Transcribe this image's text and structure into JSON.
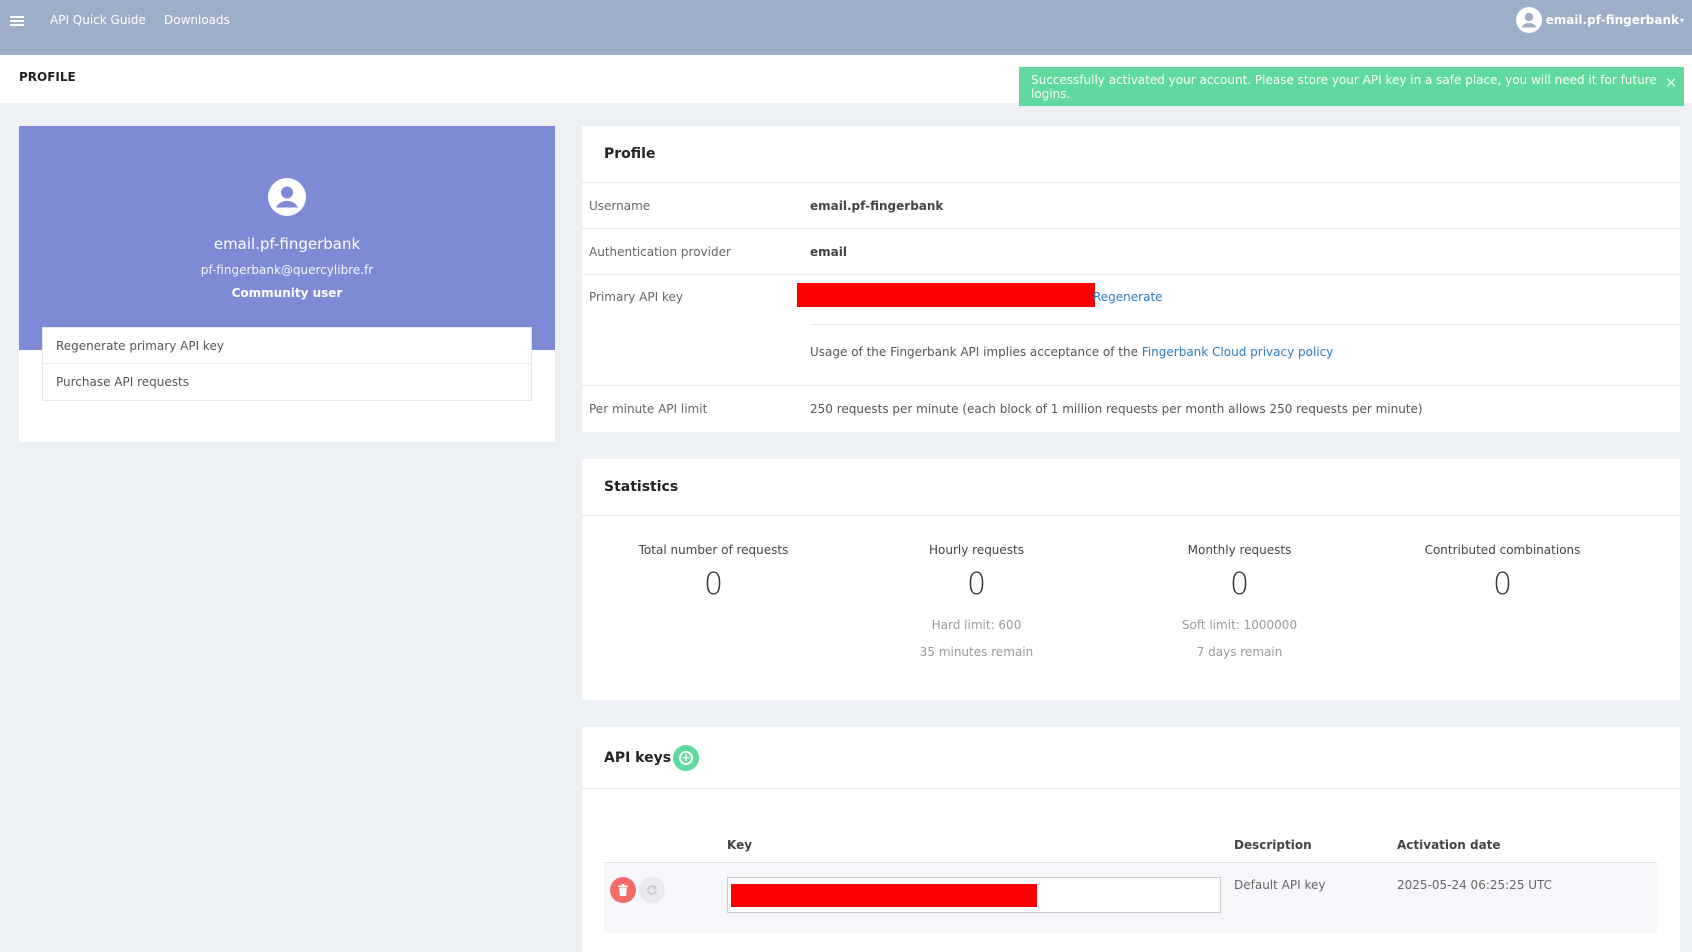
{
  "nav": {
    "links": [
      "API Quick Guide",
      "Downloads"
    ],
    "user": "email.pf-fingerbank"
  },
  "page_title": "PROFILE",
  "toast": {
    "message": "Successfully activated your account. Please store your API key in a safe place, you will need it for future logins.",
    "close": "×"
  },
  "sidebar": {
    "username": "email.pf-fingerbank",
    "email": "pf-fingerbank@quercylibre.fr",
    "role": "Community user",
    "menu": [
      "Regenerate primary API key",
      "Purchase API requests"
    ]
  },
  "profile": {
    "title": "Profile",
    "rows": {
      "username_label": "Username",
      "username_value": "email.pf-fingerbank",
      "auth_label": "Authentication provider",
      "auth_value": "email",
      "api_key_label": "Primary API key",
      "regenerate": "Regenerate",
      "usage_text": "Usage of the Fingerbank API implies acceptance of the",
      "privacy_link": "Fingerbank Cloud privacy policy",
      "limit_label": "Per minute API limit",
      "limit_value": "250 requests per minute (each block of 1 million requests per month allows 250 requests per minute)"
    }
  },
  "statistics": {
    "title": "Statistics",
    "items": [
      {
        "label": "Total number of requests",
        "value": "0",
        "sub": "",
        "sub2": ""
      },
      {
        "label": "Hourly requests",
        "value": "0",
        "sub": "Hard limit: 600",
        "sub2": "35 minutes remain"
      },
      {
        "label": "Monthly requests",
        "value": "0",
        "sub": "Soft limit: 1000000",
        "sub2": "7 days remain"
      },
      {
        "label": "Contributed combinations",
        "value": "0",
        "sub": "",
        "sub2": ""
      }
    ]
  },
  "api_keys": {
    "title": "API keys",
    "columns": [
      "Key",
      "Description",
      "Activation date"
    ],
    "rows": [
      {
        "description": "Default API key",
        "activation_date": "2025-05-24 06:25:25 UTC"
      }
    ]
  },
  "colors": {
    "topbar": "#9eaec8",
    "hero": "#7e8ad6",
    "success": "#5fd99d",
    "link": "#2b7bbd",
    "redaction": "#ff0000",
    "delete": "#f26b6b"
  }
}
